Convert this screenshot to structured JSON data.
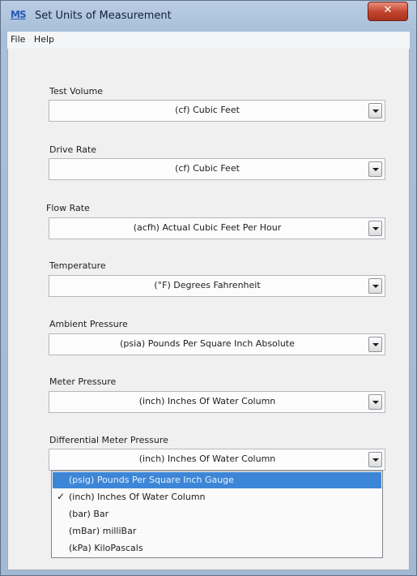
{
  "window": {
    "title": "Set Units of Measurement",
    "app_icon_text": "MS",
    "close_glyph": "✕"
  },
  "menu": [
    {
      "label": "File"
    },
    {
      "label": "Help"
    }
  ],
  "fields": [
    {
      "label": "Test Volume",
      "value": "(cf) Cubic Feet"
    },
    {
      "label": "Drive Rate",
      "value": "(cf) Cubic Feet"
    },
    {
      "label": "Flow Rate",
      "value": "(acfh) Actual Cubic Feet Per Hour"
    },
    {
      "label": "Temperature",
      "value": "(°F) Degrees Fahrenheit"
    },
    {
      "label": "Ambient Pressure",
      "value": "(psia) Pounds Per Square Inch  Absolute"
    },
    {
      "label": "Meter Pressure",
      "value": "(inch) Inches Of Water Column"
    },
    {
      "label": "Differential Meter Pressure",
      "value": "(inch) Inches Of Water Column"
    }
  ],
  "dropdown": {
    "options": [
      {
        "label": "(psig) Pounds Per Square Inch  Gauge",
        "highlighted": true,
        "checked": false
      },
      {
        "label": "(inch) Inches Of Water Column",
        "highlighted": false,
        "checked": true
      },
      {
        "label": "(bar) Bar",
        "highlighted": false,
        "checked": false
      },
      {
        "label": "(mBar) milliBar",
        "highlighted": false,
        "checked": false
      },
      {
        "label": "(kPa) KiloPascals",
        "highlighted": false,
        "checked": false
      }
    ],
    "check_glyph": "✓"
  },
  "colors": {
    "highlight": "#3d86d7",
    "close_button": "#c0432a"
  }
}
